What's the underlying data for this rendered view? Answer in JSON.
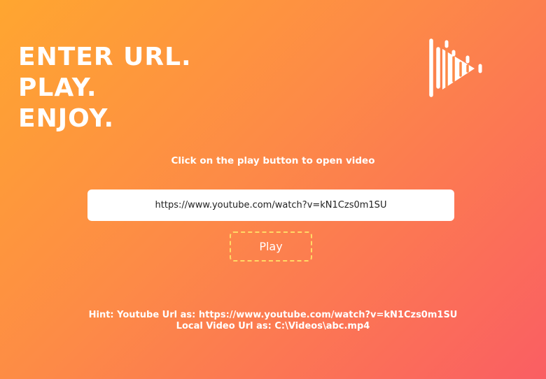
{
  "headline": {
    "line1": "ENTER URL.",
    "line2": "PLAY.",
    "line3": "ENJOY."
  },
  "logo": {
    "icon": "audio-play-logo-icon",
    "color": "#ffffff"
  },
  "instruction": "Click on the play button to open video",
  "url_input": {
    "value": "https://www.youtube.com/watch?v=kN1Czs0m1SU",
    "placeholder": ""
  },
  "play_button": {
    "label": "Play",
    "border_color": "#ffd966"
  },
  "hint": {
    "line1": "Hint: Youtube Url as: https://www.youtube.com/watch?v=kN1Czs0m1SU",
    "line2": "Local Video Url as: C:\\Videos\\abc.mp4"
  },
  "colors": {
    "gradient_start": "#ffa630",
    "gradient_end": "#fa5e63"
  }
}
